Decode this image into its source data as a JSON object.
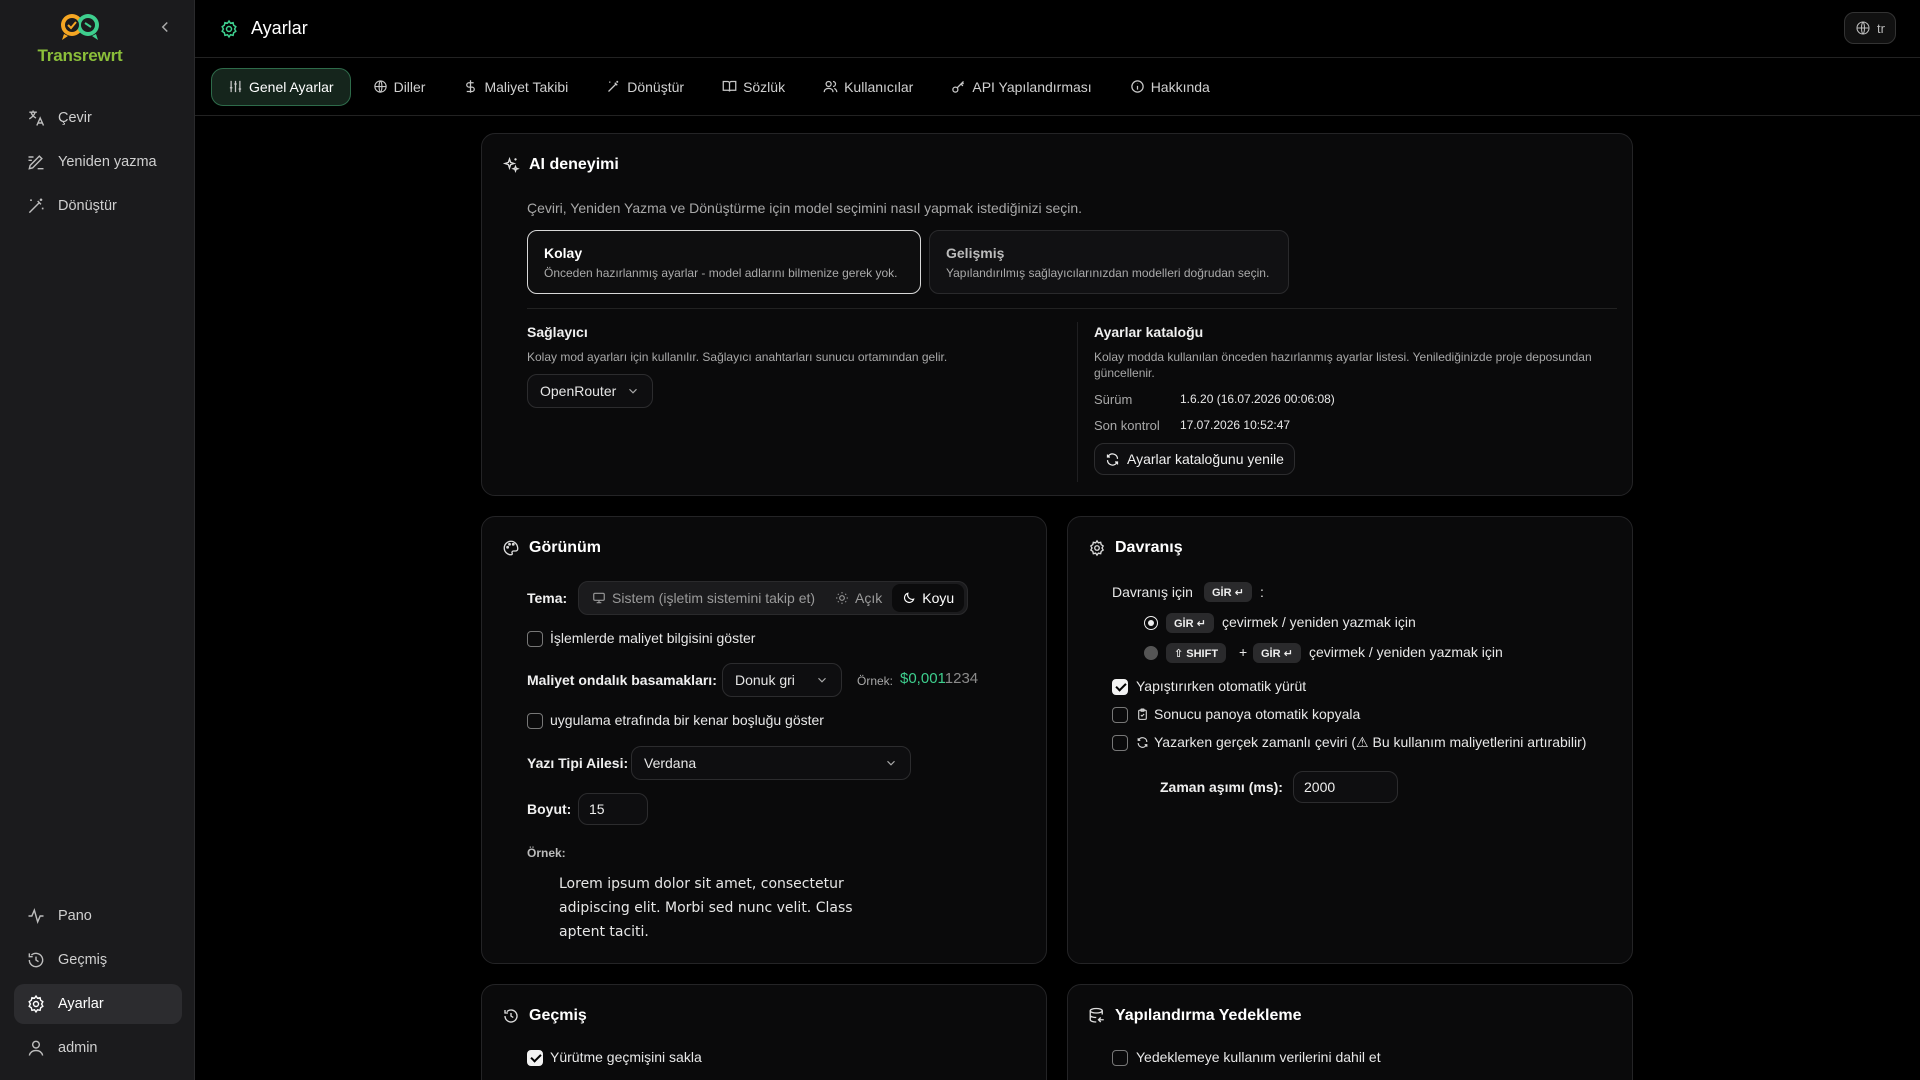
{
  "app": {
    "name": "Transrewrt"
  },
  "sidebar": {
    "top_items": [
      {
        "label": "Çevir",
        "icon": "translate-icon"
      },
      {
        "label": "Yeniden yazma",
        "icon": "rewrite-icon"
      },
      {
        "label": "Dönüştür",
        "icon": "magic-wand-icon"
      }
    ],
    "bottom_items": [
      {
        "label": "Pano",
        "icon": "activity-icon"
      },
      {
        "label": "Geçmiş",
        "icon": "history-icon"
      },
      {
        "label": "Ayarlar",
        "icon": "gear-icon",
        "active": true
      },
      {
        "label": "admin",
        "icon": "user-icon"
      }
    ]
  },
  "header": {
    "title": "Ayarlar",
    "lang": "tr"
  },
  "tabs": [
    {
      "label": "Genel Ayarlar",
      "active": true
    },
    {
      "label": "Diller"
    },
    {
      "label": "Maliyet Takibi"
    },
    {
      "label": "Dönüştür"
    },
    {
      "label": "Sözlük"
    },
    {
      "label": "Kullanıcılar"
    },
    {
      "label": "API Yapılandırması"
    },
    {
      "label": "Hakkında"
    }
  ],
  "ai": {
    "title": "AI deneyimi",
    "desc": "Çeviri, Yeniden Yazma ve Dönüştürme için model seçimini nasıl yapmak istediğinizi seçin.",
    "easy": {
      "title": "Kolay",
      "desc": "Önceden hazırlanmış ayarlar - model adlarını bilmenize gerek yok."
    },
    "advanced": {
      "title": "Gelişmiş",
      "desc": "Yapılandırılmış sağlayıcılarınızdan modelleri doğrudan seçin."
    },
    "provider": {
      "label": "Sağlayıcı",
      "desc": "Kolay mod ayarları için kullanılır. Sağlayıcı anahtarları sunucu ortamından gelir.",
      "value": "OpenRouter"
    },
    "catalog": {
      "label": "Ayarlar kataloğu",
      "desc_line1": "Kolay modda kullanılan önceden hazırlanmış ayarlar listesi. Yenilediğinizde proje deposundan",
      "desc_line2": "güncellenir.",
      "version_label": "Sürüm",
      "version_value": "1.6.20 (16.07.2026 00:06:08)",
      "check_label": "Son kontrol",
      "check_value": "17.07.2026 10:52:47",
      "refresh_label": "Ayarlar kataloğunu yenile"
    }
  },
  "appearance": {
    "title": "Görünüm",
    "theme_label": "Tema:",
    "theme_options": [
      {
        "label": "Sistem (işletim sistemini takip et)",
        "icon": "monitor-icon"
      },
      {
        "label": "Açık",
        "icon": "sun-icon"
      },
      {
        "label": "Koyu",
        "icon": "moon-icon",
        "active": true
      }
    ],
    "show_cost": {
      "label": "İşlemlerde maliyet bilgisini göster",
      "checked": false
    },
    "decimals": {
      "label": "Maliyet ondalık basamakları:",
      "value": "Donuk gri",
      "example_label": "Örnek:",
      "example_strong": "$0,001",
      "example_dim": "1234"
    },
    "padding": {
      "label": "uygulama etrafında bir kenar boşluğu göster",
      "checked": false
    },
    "font_family": {
      "label": "Yazı Tipi Ailesi:",
      "value": "Verdana"
    },
    "font_size": {
      "label": "Boyut:",
      "value": "15"
    },
    "preview": {
      "label": "Örnek:",
      "line1": "Lorem ipsum dolor sit amet, consectetur",
      "line2": "adipiscing elit. Morbi sed nunc velit. Class",
      "line3": "aptent taciti."
    }
  },
  "behavior": {
    "title": "Davranış",
    "for_label": "Davranış için",
    "enter_key": "GİR ↵",
    "colon": ":",
    "shift_key": "⇧ SHIFT",
    "plus": "+",
    "option_text": "çevirmek / yeniden yazmak için",
    "auto_run": {
      "label": "Yapıştırırken otomatik yürüt",
      "checked": true
    },
    "auto_copy": {
      "label": "Sonucu panoya otomatik kopyala",
      "checked": false
    },
    "realtime": {
      "label": "Yazarken gerçek zamanlı çeviri (⚠ Bu kullanım maliyetlerini artırabilir)",
      "checked": false
    },
    "timeout": {
      "label": "Zaman aşımı (ms):",
      "value": "2000"
    }
  },
  "history": {
    "title": "Geçmiş",
    "keep": {
      "label": "Yürütme geçmişini sakla",
      "checked": true
    }
  },
  "backup": {
    "title": "Yapılandırma Yedekleme",
    "include_usage": {
      "label": "Yedeklemeye kullanım verilerini dahil et",
      "checked": false
    }
  },
  "colors": {
    "accent": "#3ecf8e",
    "bg": "#000000",
    "sidebar": "#1b1b1d"
  }
}
